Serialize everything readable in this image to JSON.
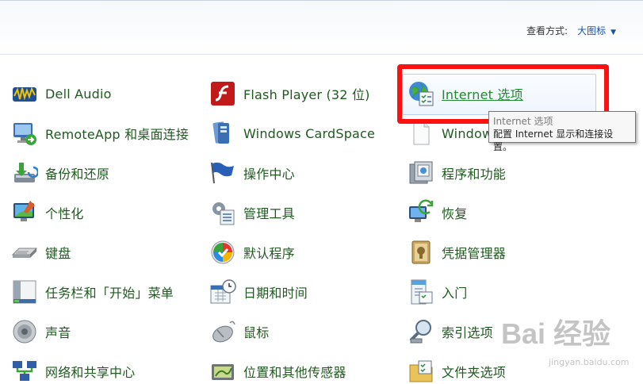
{
  "header": {
    "view_by_label": "查看方式:",
    "view_by_value": "大图标",
    "caret": "▼"
  },
  "items": [
    {
      "label": "Dell Audio",
      "icon": "dell-audio-icon"
    },
    {
      "label": "Flash Player (32 位)",
      "icon": "flash-player-icon"
    },
    {
      "label": "Internet 选项",
      "icon": "internet-options-icon"
    },
    {
      "label": "RemoteApp 和桌面连接",
      "icon": "remoteapp-icon"
    },
    {
      "label": "Windows CardSpace",
      "icon": "cardspace-icon"
    },
    {
      "label": "Window",
      "icon": "windows-document-icon"
    },
    {
      "label": "备份和还原",
      "icon": "backup-restore-icon"
    },
    {
      "label": "操作中心",
      "icon": "action-center-flag-icon"
    },
    {
      "label": "程序和功能",
      "icon": "programs-features-icon"
    },
    {
      "label": "个性化",
      "icon": "personalization-icon"
    },
    {
      "label": "管理工具",
      "icon": "admin-tools-icon"
    },
    {
      "label": "恢复",
      "icon": "recovery-icon"
    },
    {
      "label": "键盘",
      "icon": "keyboard-icon"
    },
    {
      "label": "默认程序",
      "icon": "default-programs-icon"
    },
    {
      "label": "凭据管理器",
      "icon": "credential-manager-icon"
    },
    {
      "label": "任务栏和「开始」菜单",
      "icon": "taskbar-icon"
    },
    {
      "label": "日期和时间",
      "icon": "date-time-icon"
    },
    {
      "label": "入门",
      "icon": "getting-started-icon"
    },
    {
      "label": "声音",
      "icon": "sound-icon"
    },
    {
      "label": "鼠标",
      "icon": "mouse-icon"
    },
    {
      "label": "索引选项",
      "icon": "indexing-icon"
    },
    {
      "label": "网络和共享中心",
      "icon": "network-icon"
    },
    {
      "label": "位置和其他传感器",
      "icon": "location-sensors-icon"
    },
    {
      "label": "文件夹选项",
      "icon": "folder-options-icon"
    }
  ],
  "tooltip": {
    "title": "Internet 选项",
    "body": "配置 Internet 显示和连接设置。"
  },
  "watermark": {
    "text": "Bai 经验",
    "url": "jingyan.baidu.com"
  },
  "colors": {
    "link": "#1e5a1e",
    "link_hover": "#1f8a2e",
    "annotation": "#ff1010",
    "view_by": "#1a52a8"
  }
}
